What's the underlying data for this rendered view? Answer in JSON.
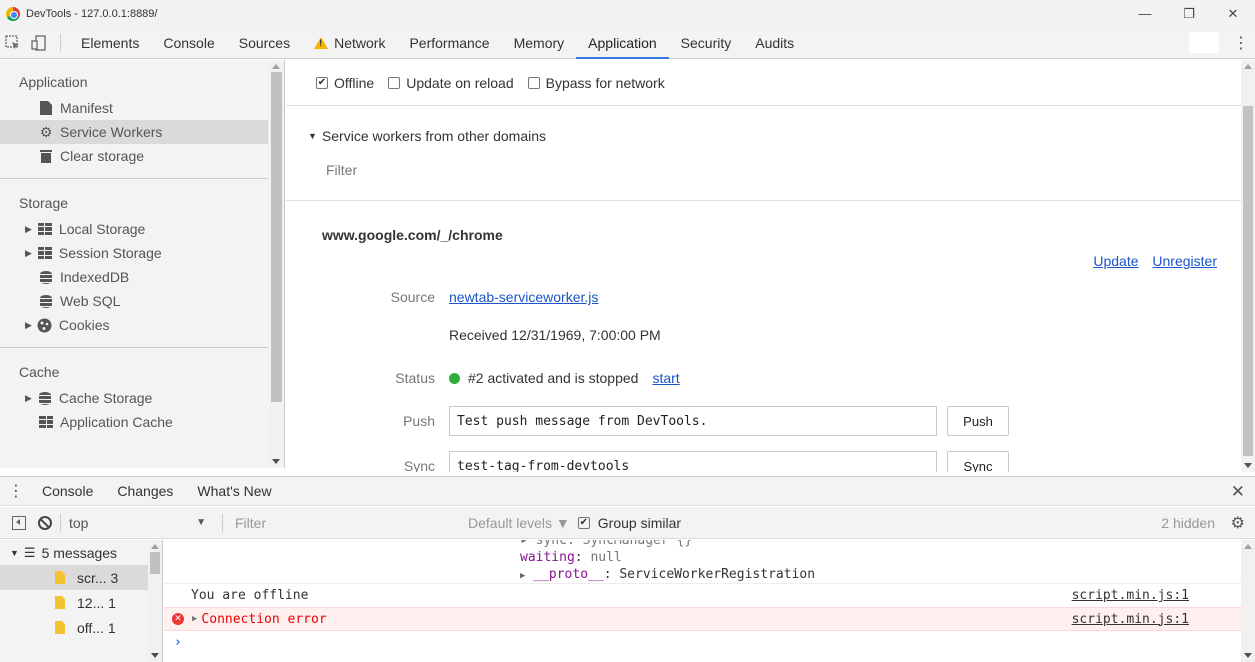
{
  "window": {
    "title": "DevTools - 127.0.0.1:8889/"
  },
  "main_tabs": [
    {
      "label": "Elements"
    },
    {
      "label": "Console"
    },
    {
      "label": "Sources"
    },
    {
      "label": "Network"
    },
    {
      "label": "Performance"
    },
    {
      "label": "Memory"
    },
    {
      "label": "Application"
    },
    {
      "label": "Security"
    },
    {
      "label": "Audits"
    }
  ],
  "sidebar": {
    "application": {
      "title": "Application",
      "items": [
        {
          "label": "Manifest"
        },
        {
          "label": "Service Workers"
        },
        {
          "label": "Clear storage"
        }
      ]
    },
    "storage": {
      "title": "Storage",
      "items": [
        {
          "label": "Local Storage"
        },
        {
          "label": "Session Storage"
        },
        {
          "label": "IndexedDB"
        },
        {
          "label": "Web SQL"
        },
        {
          "label": "Cookies"
        }
      ]
    },
    "cache": {
      "title": "Cache",
      "items": [
        {
          "label": "Cache Storage"
        },
        {
          "label": "Application Cache"
        }
      ]
    }
  },
  "sw_toolbar": {
    "offline": {
      "label": "Offline",
      "checked": true
    },
    "update_on_reload": {
      "label": "Update on reload",
      "checked": false
    },
    "bypass_network": {
      "label": "Bypass for network",
      "checked": false
    }
  },
  "other_domains": {
    "label": "Service workers from other domains",
    "filter_placeholder": "Filter"
  },
  "worker": {
    "origin": "www.google.com/_/chrome",
    "update_label": "Update",
    "unregister_label": "Unregister",
    "source_label": "Source",
    "source_file": "newtab-serviceworker.js",
    "received": "Received 12/31/1969, 7:00:00 PM",
    "status_label": "Status",
    "status_text": "#2 activated and is stopped",
    "status_color": "#2eae38",
    "start_label": "start",
    "push_label": "Push",
    "push_value": "Test push message from DevTools.",
    "push_button": "Push",
    "sync_label": "Sync",
    "sync_value": "test-tag-from-devtools",
    "sync_button": "Sync"
  },
  "drawer": {
    "tabs": [
      {
        "label": "Console"
      },
      {
        "label": "Changes"
      },
      {
        "label": "What's New"
      }
    ]
  },
  "console_toolbar": {
    "context": "top",
    "filter_placeholder": "Filter",
    "levels": "Default levels ▼",
    "group_similar": "Group similar",
    "hidden": "2 hidden"
  },
  "console_sidebar": {
    "messages": "5 messages",
    "items": [
      {
        "name": "scr...",
        "count": "3"
      },
      {
        "name": "12...",
        "count": "1"
      },
      {
        "name": "off...",
        "count": "1"
      }
    ]
  },
  "console": {
    "obj_line_cut": "▸ sync: SyncManager {}",
    "waiting_key": "waiting",
    "waiting_val": "null",
    "proto_key": "__proto__",
    "proto_val": "ServiceWorkerRegistration",
    "messages": [
      {
        "text": "You are offline",
        "source": "script.min.js:1",
        "level": "info"
      },
      {
        "text": "Connection error",
        "source": "script.min.js:1",
        "level": "error"
      }
    ],
    "prompt": "›"
  }
}
